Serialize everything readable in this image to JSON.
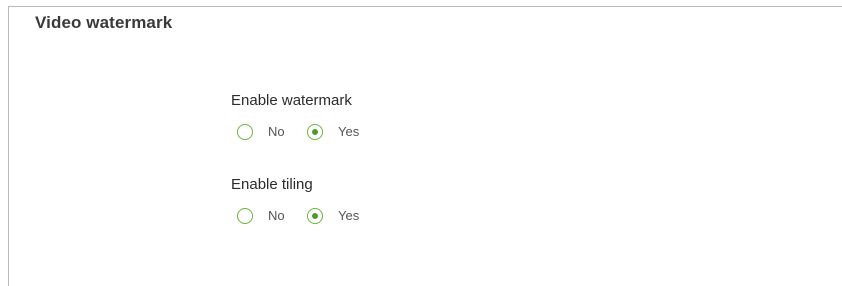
{
  "section": {
    "title": "Video watermark"
  },
  "settings": [
    {
      "label": "Enable watermark",
      "options": [
        {
          "label": "No",
          "selected": false
        },
        {
          "label": "Yes",
          "selected": true
        }
      ]
    },
    {
      "label": "Enable tiling",
      "options": [
        {
          "label": "No",
          "selected": false
        },
        {
          "label": "Yes",
          "selected": true
        }
      ]
    }
  ],
  "colors": {
    "radio_accent": "#6cb33f",
    "radio_dot": "#4f9a2a",
    "panel_border": "#b9b9b9"
  }
}
